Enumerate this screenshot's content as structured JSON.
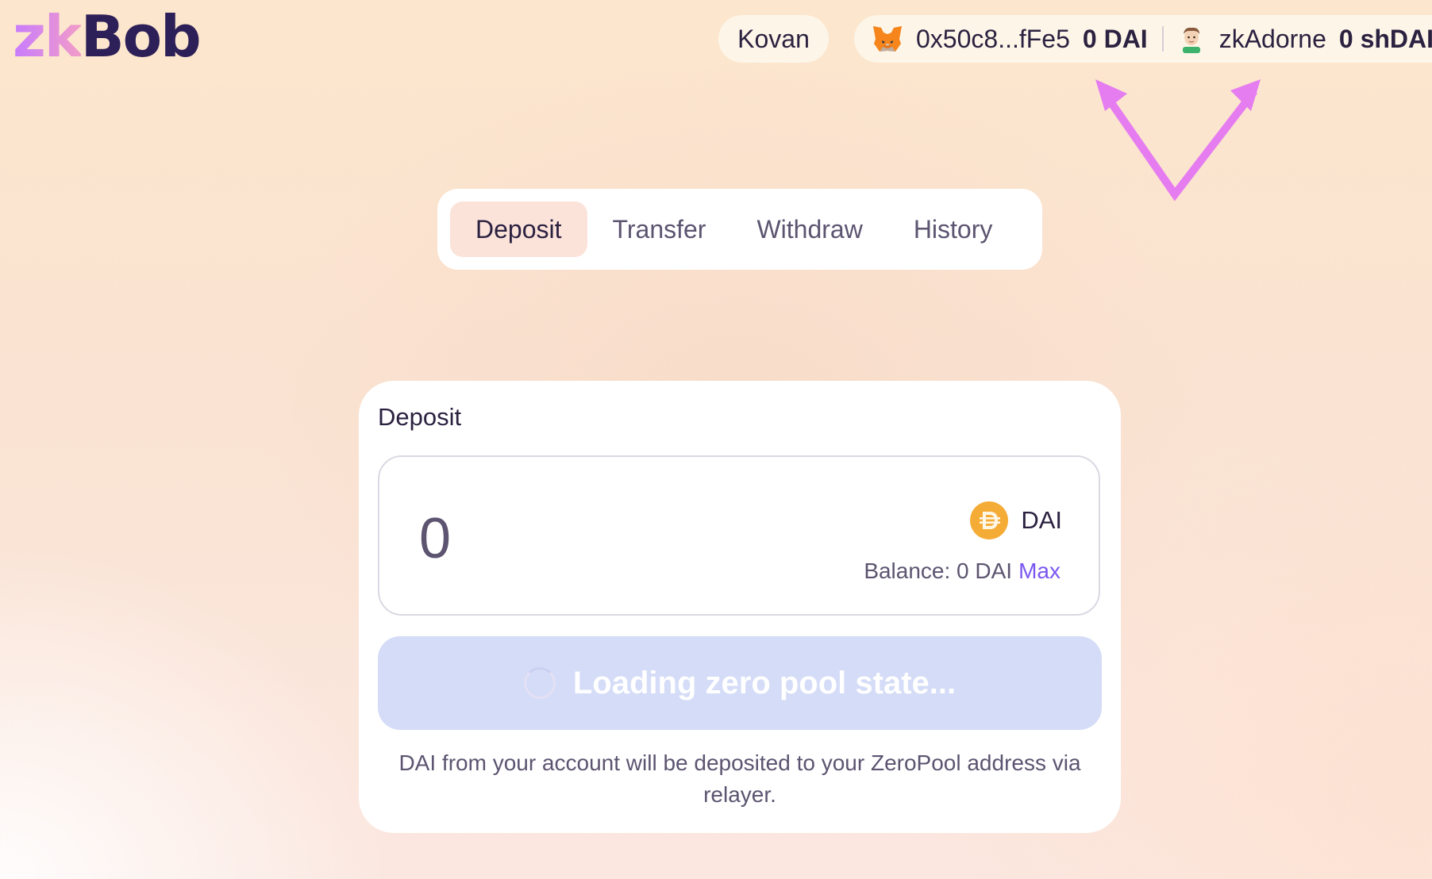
{
  "header": {
    "logo": {
      "part1": "zk",
      "part2": "Bob"
    },
    "network": "Kovan",
    "account": {
      "wallet_icon": "metamask-fox-icon",
      "address": "0x50c8...fFe5",
      "balance": "0 DAI",
      "avatar_icon": "user-avatar-icon",
      "zk_name": "zkAdorne",
      "shielded_balance": "0 shDAI"
    }
  },
  "tabs": [
    {
      "label": "Deposit",
      "active": true
    },
    {
      "label": "Transfer",
      "active": false
    },
    {
      "label": "Withdraw",
      "active": false
    },
    {
      "label": "History",
      "active": false
    }
  ],
  "card": {
    "title": "Deposit",
    "amount_value": "0",
    "token": {
      "icon": "dai-coin-icon",
      "symbol": "DAI"
    },
    "balance_text": "Balance: 0 DAI",
    "max_label": "Max",
    "button_label": "Loading zero pool state...",
    "note": "DAI from your account will be deposited to your ZeroPool address via relayer."
  },
  "colors": {
    "accent": "#7a56f0",
    "logo_gradient_start": "#c77bfd",
    "logo_gradient_end": "#f29cc8",
    "logo_dark": "#2d1f57",
    "button_disabled": "#d4dcf7",
    "annotation_arrow": "#e57cf0",
    "dai_gold": "#f5ac37"
  }
}
